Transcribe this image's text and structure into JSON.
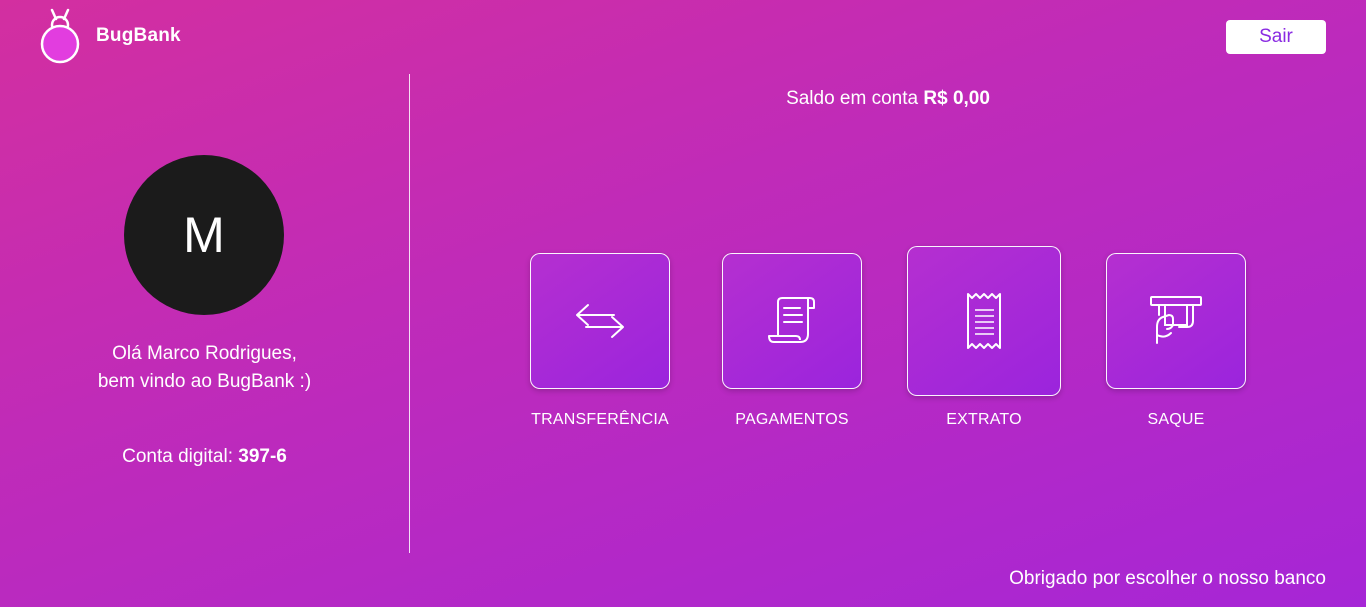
{
  "app": {
    "name": "BugBank",
    "logout_label": "Sair"
  },
  "user": {
    "avatar_initial": "M",
    "greeting_line1": "Olá Marco Rodrigues,",
    "greeting_line2": "bem vindo ao BugBank :)",
    "account_label": "Conta digital:",
    "account_number": "397-6"
  },
  "balance": {
    "label": "Saldo em conta",
    "value": "R$ 0,00"
  },
  "actions": [
    {
      "label": "TRANSFERÊNCIA",
      "icon": "transfer-arrows-icon"
    },
    {
      "label": "PAGAMENTOS",
      "icon": "payment-scroll-icon"
    },
    {
      "label": "EXTRATO",
      "icon": "receipt-icon"
    },
    {
      "label": "SAQUE",
      "icon": "cash-withdraw-icon"
    }
  ],
  "footer": {
    "text": "Obrigado por escolher o nosso banco"
  },
  "colors": {
    "background_start": "#d32fa0",
    "background_end": "#a626d6",
    "accent": "#8a2be2",
    "avatar_bg": "#1b1b1b"
  }
}
